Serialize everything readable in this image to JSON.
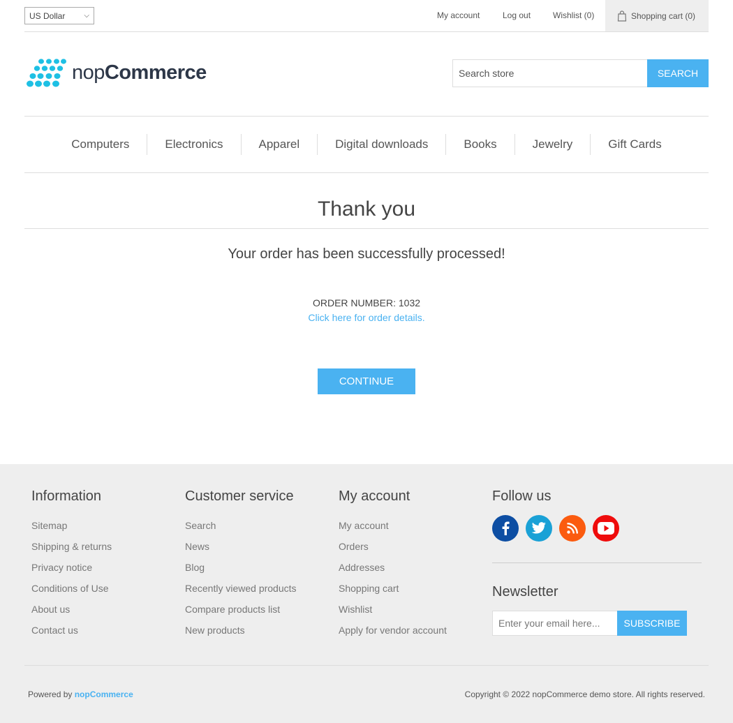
{
  "header": {
    "currency": "US Dollar",
    "links": {
      "my_account": "My account",
      "log_out": "Log out",
      "wishlist": "Wishlist (0)",
      "shopping_cart": "Shopping cart (0)"
    },
    "search": {
      "placeholder": "Search store",
      "button": "SEARCH"
    },
    "logo": {
      "text_light": "nop",
      "text_bold": "Commerce"
    }
  },
  "menu": {
    "items": [
      "Computers",
      "Electronics",
      "Apparel",
      "Digital downloads",
      "Books",
      "Jewelry",
      "Gift Cards"
    ]
  },
  "main": {
    "title": "Thank you",
    "message": "Your order has been successfully processed!",
    "order_number": "ORDER NUMBER: 1032",
    "details_link": "Click here for order details.",
    "continue": "CONTINUE"
  },
  "footer": {
    "information": {
      "title": "Information",
      "items": [
        "Sitemap",
        "Shipping & returns",
        "Privacy notice",
        "Conditions of Use",
        "About us",
        "Contact us"
      ]
    },
    "customer_service": {
      "title": "Customer service",
      "items": [
        "Search",
        "News",
        "Blog",
        "Recently viewed products",
        "Compare products list",
        "New products"
      ]
    },
    "my_account": {
      "title": "My account",
      "items": [
        "My account",
        "Orders",
        "Addresses",
        "Shopping cart",
        "Wishlist",
        "Apply for vendor account"
      ]
    },
    "follow": {
      "title": "Follow us",
      "icons": [
        "facebook-icon",
        "twitter-icon",
        "rss-icon",
        "youtube-icon"
      ],
      "colors": {
        "facebook": "#0d4ea3",
        "twitter": "#1aa1d6",
        "rss": "#fb5b0f",
        "youtube": "#ef0c0c"
      }
    },
    "newsletter": {
      "title": "Newsletter",
      "placeholder": "Enter your email here...",
      "button": "SUBSCRIBE"
    },
    "powered_by": "Powered by",
    "powered_link": "nopCommerce",
    "copyright": "Copyright © 2022 nopCommerce demo store. All rights reserved."
  },
  "colors": {
    "accent": "#4ab2f1",
    "logo_dots": "#1ec0e4",
    "footer_bg": "#eeeeee"
  }
}
